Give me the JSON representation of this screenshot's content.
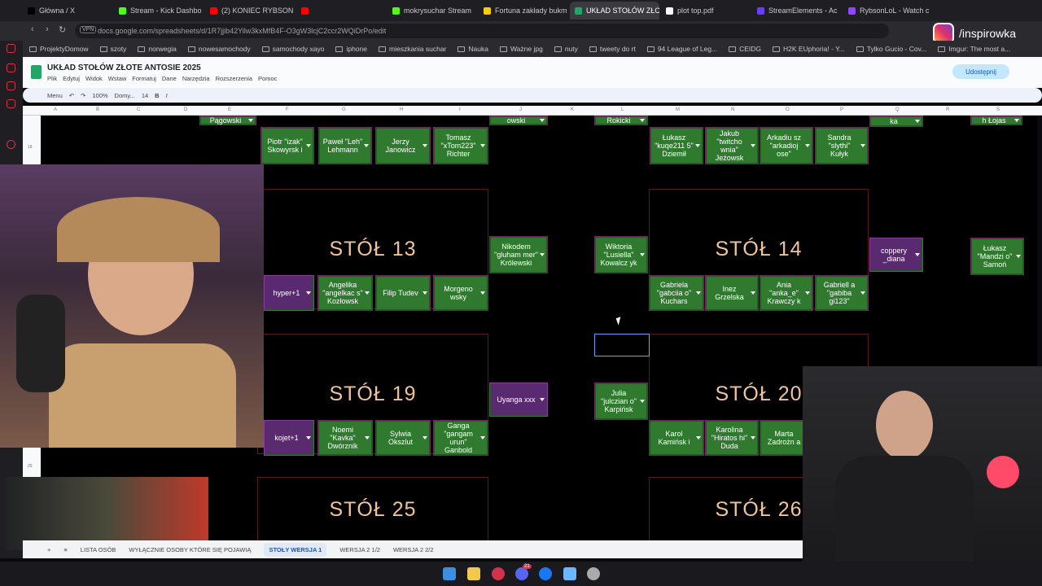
{
  "browser": {
    "tabs": [
      {
        "label": "Główna / X",
        "color": "#000000"
      },
      {
        "label": "Stream - Kick Dashbo",
        "color": "#53fc18"
      },
      {
        "label": "(2) KONIEC RYBSON",
        "color": "#ff0000"
      },
      {
        "label": "",
        "color": "#ff0000"
      },
      {
        "label": "mokrysuchar Stream",
        "color": "#53fc18"
      },
      {
        "label": "Fortuna zakłady bukm",
        "color": "#ffcc00"
      },
      {
        "label": "UKŁAD STOŁÓW ZŁOTE",
        "color": "#23a566"
      },
      {
        "label": "plot top.pdf",
        "color": "#ffffff"
      },
      {
        "label": "StreamElements - Ac",
        "color": "#6a3cff"
      },
      {
        "label": "RybsonLoL - Watch c",
        "color": "#9146ff"
      }
    ],
    "url": "docs.google.com/spreadsheets/d/1R7jjib42Yilw3kxMfB4F-O3gW3lcjC2ccr2WQiDrPo/edit",
    "vpn": "VPN",
    "bookmarks": [
      "ProjektyDomow",
      "szoty",
      "norwegia",
      "nowesamochody",
      "samochody xayo",
      "iphone",
      "mieszkania suchar",
      "Nauka",
      "Ważne jpg",
      "nuty",
      "tweety do rt",
      "94 League of Leg...",
      "CEIDG",
      "H2K EUphoria! - Y...",
      "Tylko Gucio - Cov...",
      "Imgur: The most a..."
    ]
  },
  "overlay": {
    "instagram_handle": "/inspirowka"
  },
  "sheets": {
    "title": "UKŁAD STOŁÓW ZŁOTE ANTOSIE 2025",
    "menu": [
      "Plik",
      "Edytuj",
      "Widok",
      "Wstaw",
      "Formatuj",
      "Dane",
      "Narzędzia",
      "Rozszerzenia",
      "Pomoc"
    ],
    "share_label": "Udostępnij",
    "toolbar": {
      "search": "Menu",
      "zoom": "100%",
      "font": "Domy...",
      "size": "14"
    },
    "columns": [
      "A",
      "B",
      "C",
      "D",
      "E",
      "F",
      "G",
      "H",
      "I",
      "J",
      "K",
      "L",
      "M",
      "N",
      "O",
      "P",
      "Q",
      "R",
      "S"
    ],
    "rows": [
      "18",
      "29"
    ],
    "sheet_tabs": [
      "LISTA OSÓB",
      "WYŁĄCZNIE OSOBY KTÓRE SIĘ POJAWIĄ",
      "STOŁY WERSJA 1",
      "WERSJA 2 1/2",
      "WERSJA 2 2/2"
    ],
    "tables": [
      "STÓŁ 13",
      "STÓŁ 14",
      "STÓŁ 19",
      "STÓŁ 20",
      "STÓŁ 25",
      "STÓŁ 26"
    ],
    "chips": {
      "top_pagowski": "Pągowski",
      "top_owski": "owski",
      "top_rokicki": "Rokicki",
      "top_lojas": "h Łojas",
      "top_kadawska": "ka",
      "r1_piotr": "Piotr \"izak\" Skowyrsk i",
      "r1_pawel": "Paweł \"Leh\" Lehmann",
      "r1_jerzy": "Jerzy Janowicz",
      "r1_tomasz": "Tomasz \"xTom223\" Richter",
      "r1_lukasz": "Łukasz \"kuqe211 5\" Dziemił",
      "r1_jakub": "Jakub \"twitcho wnia\" Jeżowsk",
      "r1_arkadiusz": "Arkadiu sz \"arkadioj ose\"",
      "r1_sandra": "Sandra \"slythi\" Kułyk",
      "t13_nikodem": "Nikodem \"gluham mer\" Królewski",
      "t13_wiktoria": "Wiktoria \"Lusiella\" Kowalcz yk",
      "t13_hyper": "hyper+1",
      "t13_angelika": "Angelika \"angelkac s\" Kozłowsk",
      "t13_filip": "Filip Tudev",
      "t13_morgeno": "Morgeno wsky",
      "t14_coppery": "coppery _diana",
      "t14_lukasz2": "Łukasz \"Mandzi o\" Samoń",
      "t14_gabriela1": "Gabriela \"gabciia o\" Kuchars",
      "t14_inez": "Inez Grzelska",
      "t14_ania": "Ania \"anka_e\" Krawczy k",
      "t14_gabriela2": "Gabriell a \"gabiba gi123\"",
      "t19_uyanga": "Uyanga xxx",
      "t19_julia": "Julia \"julczian o\" Karpińsk",
      "t19_kojet": "kojet+1",
      "t19_noemi": "Noemi \"Kavka\" Dwórznik",
      "t19_sylwia": "Sylwia Okszlut",
      "t19_ganga": "Ganga \"gangam urun\" Ganbold",
      "t20_karol": "Karol Kamińsk i",
      "t20_karolina": "Karolina \"Hiratos hi\" Duda",
      "t20_marta": "Marta Zadrożn a"
    }
  },
  "taskbar": {
    "badge": "21"
  },
  "colors": {
    "chip_green": "#2f7a2f",
    "table_text": "#f0c49a",
    "accent_red": "#d1334a"
  }
}
